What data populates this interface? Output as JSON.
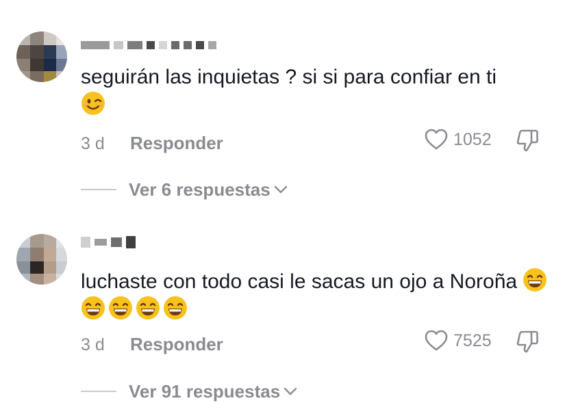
{
  "comments": [
    {
      "text": "seguirán las inquietas ? si si para confiar en ti",
      "emoji": "winking-face",
      "date": "3 d",
      "reply_label": "Responder",
      "likes": "1052",
      "view_replies": "Ver 6 respuestas"
    },
    {
      "text": "luchaste con todo casi le sacas un ojo a Noroña",
      "emoji": "grinning-face-with-smiling-eyes",
      "emoji_count": 5,
      "date": "3 d",
      "reply_label": "Responder",
      "likes": "7525",
      "view_replies": "Ver 91 respuestas"
    }
  ],
  "icons": {
    "like": "heart-outline-icon",
    "dislike": "thumbs-down-outline-icon",
    "expand": "chevron-down-icon"
  },
  "colors": {
    "text": "#161823",
    "muted": "#8a8b91",
    "emoji": "#f7c21b"
  }
}
